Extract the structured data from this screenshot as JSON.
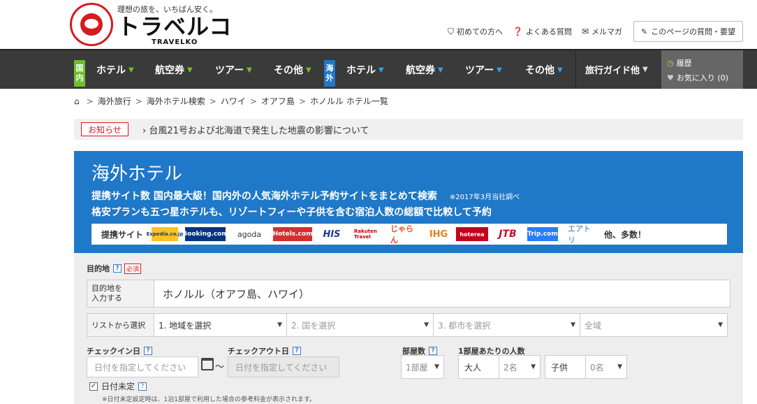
{
  "header": {
    "tagline": "理想の旅を、いちばん安く。",
    "logo_main": "トラベルコ",
    "logo_en": "TRAVELKO",
    "seal_text": "TRAVELKO TRAVELKO",
    "links": [
      {
        "icon": "shield-icon",
        "label": "初めての方へ"
      },
      {
        "icon": "help-icon",
        "label": "よくある質問"
      },
      {
        "icon": "mail-icon",
        "label": "メルマガ"
      }
    ],
    "faq_button": "このページの質問・要望"
  },
  "nav": {
    "domestic_badge": [
      "国",
      "内"
    ],
    "overseas_badge": [
      "海",
      "外"
    ],
    "domestic": [
      "ホテル",
      "航空券",
      "ツアー",
      "その他"
    ],
    "overseas": [
      "ホテル",
      "航空券",
      "ツアー",
      "その他"
    ],
    "guide": "旅行ガイド他",
    "history": "履歴",
    "favorites": "お気に入り (0)",
    "colors": {
      "domestic": "#6fbf2a",
      "overseas": "#1f78c8"
    }
  },
  "breadcrumb": [
    "海外旅行",
    "海外ホテル検索",
    "ハワイ",
    "オアフ島",
    "ホノルル ホテル一覧"
  ],
  "notice": {
    "label": "お知らせ",
    "text": "台風21号および北海道で発生した地震の影響について"
  },
  "banner": {
    "title": "海外ホテル",
    "line1": "提携サイト数 国内最大級！国内外の人気海外ホテル予約サイトをまとめて検索",
    "line1_note": "※2017年3月当社調べ",
    "line2": "格安プランも五つ星ホテルも、リゾートフィーや子供を含む宿泊人数の総額で比較して予約",
    "partners_label": "提携サイト",
    "partners": [
      "Expedia.co.jp",
      "Booking.com",
      "agoda",
      "Hotels.com",
      "HIS",
      "Rakuten Travel",
      "じゃらん",
      "IHG",
      "hoterea",
      "JTB",
      "Trip.com",
      "エアトリ"
    ],
    "partners_more": "他、多数！",
    "color": "#1f78c8"
  },
  "form": {
    "destination_label": "目的地",
    "required": "必須",
    "dest_input_label": [
      "目的地を",
      "入力する"
    ],
    "dest_value": "ホノルル（オアフ島、ハワイ）",
    "list_label": "リストから選択",
    "selects": [
      "1. 地域を選択",
      "2. 国を選択",
      "3. 都市を選択",
      "全域"
    ],
    "checkin_label": "チェックイン日",
    "checkout_label": "チェックアウト日",
    "date_placeholder": "日付を指定してください",
    "tilde": "〜",
    "rooms_label": "部屋数",
    "rooms_value": "1部屋",
    "people_label": "1部屋あたりの人数",
    "adult_label": "大人",
    "adult_value": "2名",
    "child_label": "子供",
    "child_value": "0名",
    "undecided": "日付未定",
    "note": "※日付未定設定時は、1泊1部屋で利用した場合の参考料金が表示されます。"
  }
}
